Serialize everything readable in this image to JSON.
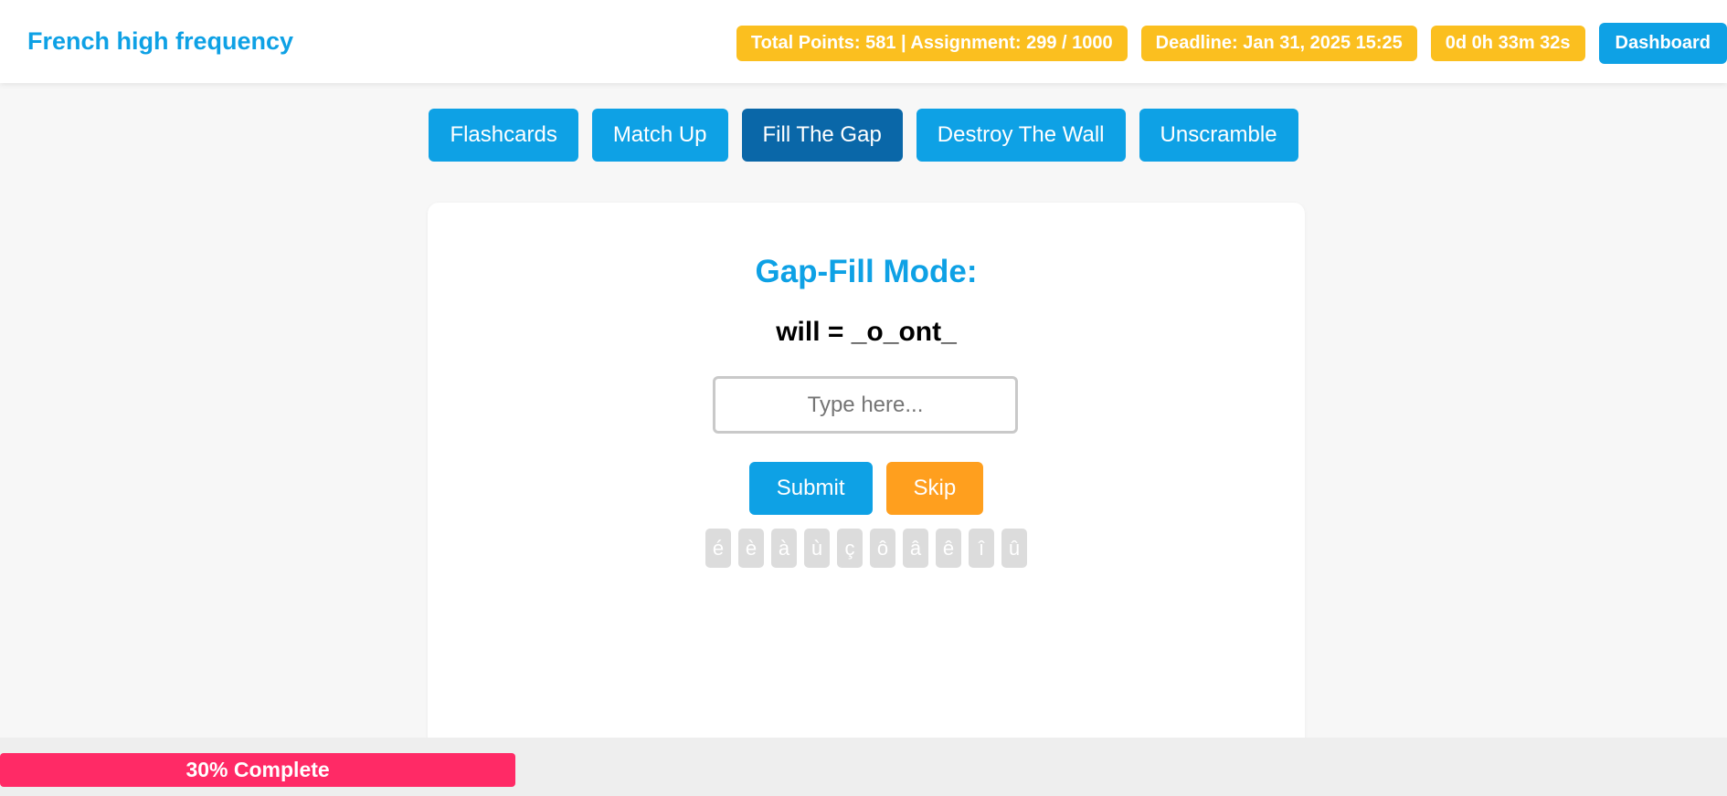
{
  "colors": {
    "accent": "#0ea1e5",
    "accent_dark": "#0a67a8",
    "yellow": "#fbbf1f",
    "orange": "#ff9f1e",
    "pink": "#ff2a66"
  },
  "header": {
    "title": "French high frequency",
    "points": "Total Points: 581 | Assignment: 299 / 1000",
    "deadline": "Deadline: Jan 31, 2025 15:25",
    "timer": "0d 0h 33m 32s",
    "dashboard_label": "Dashboard"
  },
  "tabs": [
    {
      "label": "Flashcards",
      "active": false
    },
    {
      "label": "Match Up",
      "active": false
    },
    {
      "label": "Fill The Gap",
      "active": true
    },
    {
      "label": "Destroy The Wall",
      "active": false
    },
    {
      "label": "Unscramble",
      "active": false
    }
  ],
  "game": {
    "mode_title": "Gap-Fill Mode:",
    "prompt": "will = _o_ont_",
    "input_value": "",
    "input_placeholder": "Type here...",
    "submit_label": "Submit",
    "skip_label": "Skip",
    "accents": [
      "é",
      "è",
      "à",
      "ù",
      "ç",
      "ô",
      "â",
      "ê",
      "î",
      "û"
    ]
  },
  "progress": {
    "percent": 30,
    "label": "30% Complete"
  }
}
